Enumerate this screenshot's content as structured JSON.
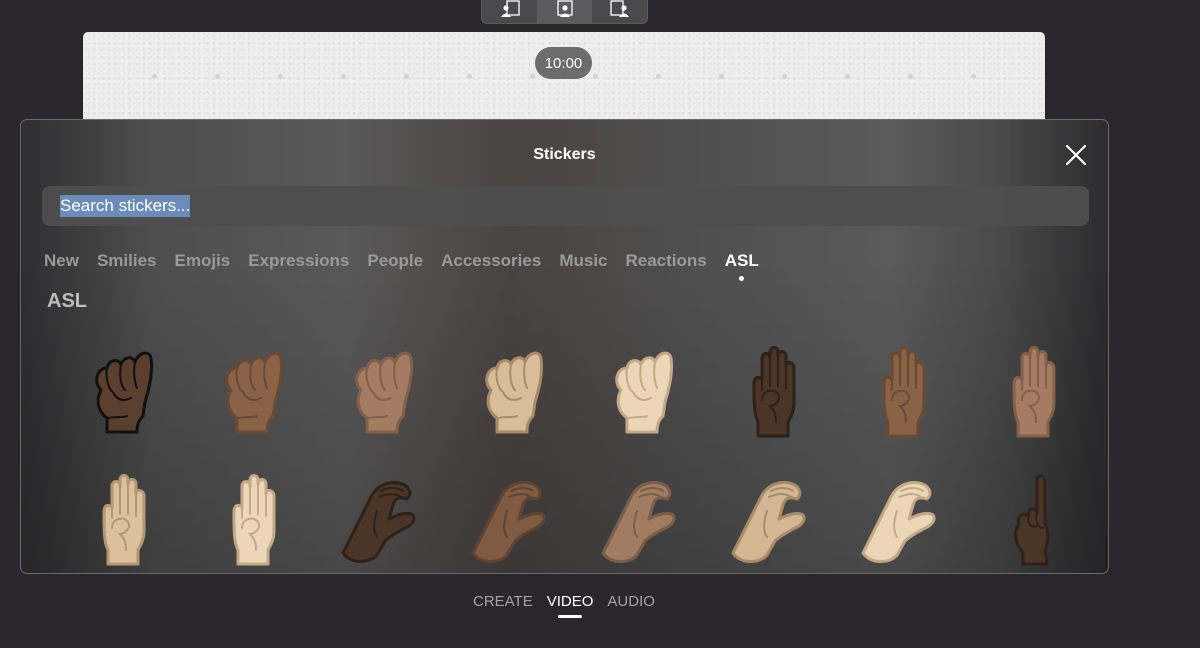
{
  "layout_switcher": {
    "options": [
      {
        "icon": "presenter-left-icon",
        "active": false
      },
      {
        "icon": "presenter-center-icon",
        "active": true
      },
      {
        "icon": "presenter-right-icon",
        "active": false
      }
    ]
  },
  "canvas": {
    "timer": "10:00"
  },
  "stickers_modal": {
    "title": "Stickers",
    "close_icon": "close-icon",
    "search": {
      "value": "",
      "placeholder": "Search stickers...",
      "selected_text": "Search stickers..."
    },
    "tabs": [
      {
        "label": "New",
        "active": false
      },
      {
        "label": "Smilies",
        "active": false
      },
      {
        "label": "Emojis",
        "active": false
      },
      {
        "label": "Expressions",
        "active": false
      },
      {
        "label": "People",
        "active": false
      },
      {
        "label": "Accessories",
        "active": false
      },
      {
        "label": "Music",
        "active": false
      },
      {
        "label": "Reactions",
        "active": false
      },
      {
        "label": "ASL",
        "active": true
      }
    ],
    "section_title": "ASL",
    "stickers": [
      {
        "sign": "A",
        "skin": "#5a3f2e",
        "outline": "#111111"
      },
      {
        "sign": "A",
        "skin": "#8a6347",
        "outline": "#6a4a34"
      },
      {
        "sign": "A",
        "skin": "#a57c62",
        "outline": "#82604a"
      },
      {
        "sign": "A",
        "skin": "#d9bd98",
        "outline": "#a88b6a"
      },
      {
        "sign": "A",
        "skin": "#ecd6b8",
        "outline": "#c4a987"
      },
      {
        "sign": "B",
        "skin": "#4a3527",
        "outline": "#2e2118"
      },
      {
        "sign": "B",
        "skin": "#8a6347",
        "outline": "#6a4a34"
      },
      {
        "sign": "B",
        "skin": "#a57c62",
        "outline": "#82604a"
      },
      {
        "sign": "B",
        "skin": "#ddc09c",
        "outline": "#b39874"
      },
      {
        "sign": "B",
        "skin": "#ecd6b8",
        "outline": "#c4a987"
      },
      {
        "sign": "C",
        "skin": "#4a3527",
        "outline": "#2e2118"
      },
      {
        "sign": "C",
        "skin": "#7e5b42",
        "outline": "#5f4431"
      },
      {
        "sign": "C",
        "skin": "#a07c62",
        "outline": "#7c5e48"
      },
      {
        "sign": "C",
        "skin": "#d4b692",
        "outline": "#a88b6a"
      },
      {
        "sign": "C",
        "skin": "#ecd6b8",
        "outline": "#c4a987"
      },
      {
        "sign": "D",
        "skin": "#4a3527",
        "outline": "#2e2118"
      }
    ]
  },
  "mode_nav": [
    {
      "label": "CREATE",
      "active": false
    },
    {
      "label": "VIDEO",
      "active": true
    },
    {
      "label": "AUDIO",
      "active": false
    }
  ]
}
